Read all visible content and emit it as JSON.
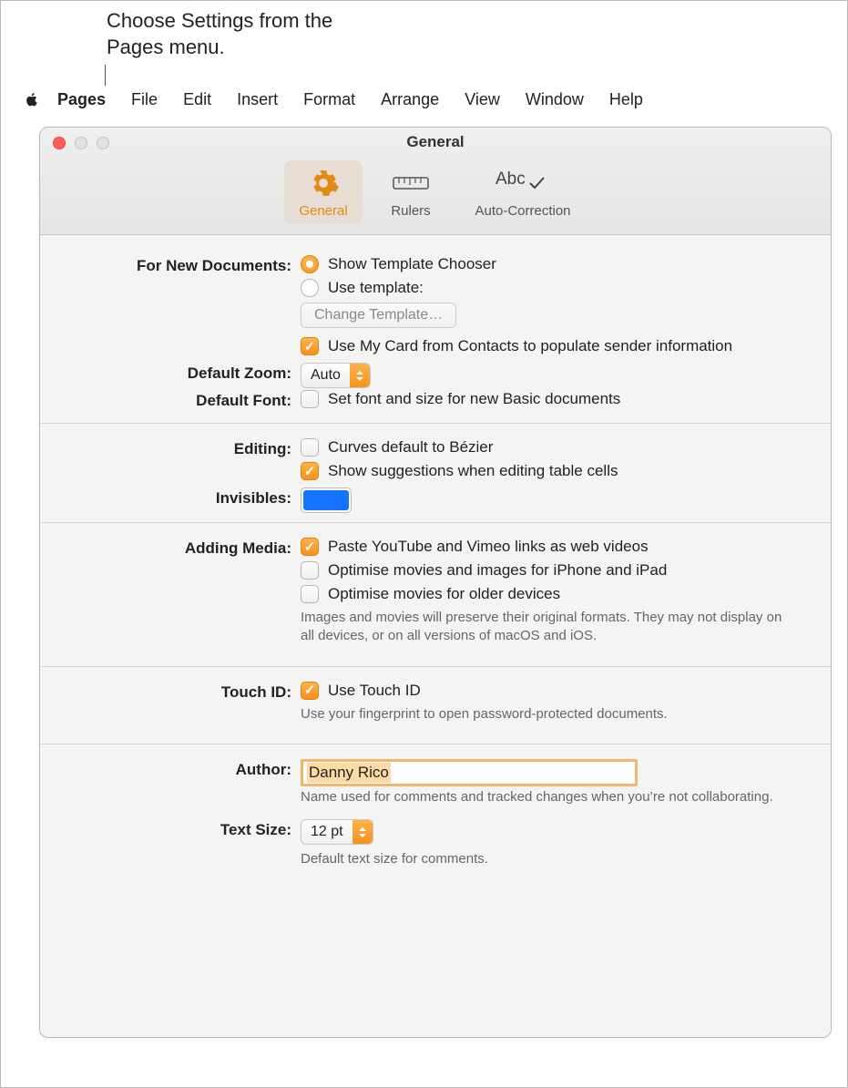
{
  "callout": {
    "text": "Choose Settings from the Pages menu."
  },
  "menubar": {
    "apple_icon": "apple-logo-icon",
    "items": [
      "Pages",
      "File",
      "Edit",
      "Insert",
      "Format",
      "Arrange",
      "View",
      "Window",
      "Help"
    ]
  },
  "window": {
    "title": "General",
    "tabs": [
      {
        "id": "general",
        "label": "General",
        "selected": true
      },
      {
        "id": "rulers",
        "label": "Rulers",
        "selected": false
      },
      {
        "id": "autocorrect",
        "label": "Auto-Correction",
        "selected": false
      }
    ]
  },
  "sections": {
    "new_documents": {
      "label": "For New Documents:",
      "radio_show_chooser": "Show Template Chooser",
      "radio_use_template": "Use template:",
      "change_template_btn": "Change Template…",
      "use_my_card": "Use My Card from Contacts to populate sender information"
    },
    "default_zoom": {
      "label": "Default Zoom:",
      "value": "Auto"
    },
    "default_font": {
      "label": "Default Font:",
      "set_font": "Set font and size for new Basic documents"
    },
    "editing": {
      "label": "Editing:",
      "curves_bezier": "Curves default to Bézier",
      "table_suggestions": "Show suggestions when editing table cells"
    },
    "invisibles": {
      "label": "Invisibles:",
      "color": "#1574ff"
    },
    "adding_media": {
      "label": "Adding Media:",
      "paste_web_videos": "Paste YouTube and Vimeo links as web videos",
      "optimise_iphone": "Optimise movies and images for iPhone and iPad",
      "optimise_older": "Optimise movies for older devices",
      "help": "Images and movies will preserve their original formats. They may not display on all devices, or on all versions of macOS and iOS."
    },
    "touch_id": {
      "label": "Touch ID:",
      "use_touch_id": "Use Touch ID",
      "help": "Use your fingerprint to open password-protected documents."
    },
    "author": {
      "label": "Author:",
      "value": "Danny Rico",
      "help": "Name used for comments and tracked changes when you’re not collaborating."
    },
    "text_size": {
      "label": "Text Size:",
      "value": "12 pt",
      "help": "Default text size for comments."
    }
  }
}
